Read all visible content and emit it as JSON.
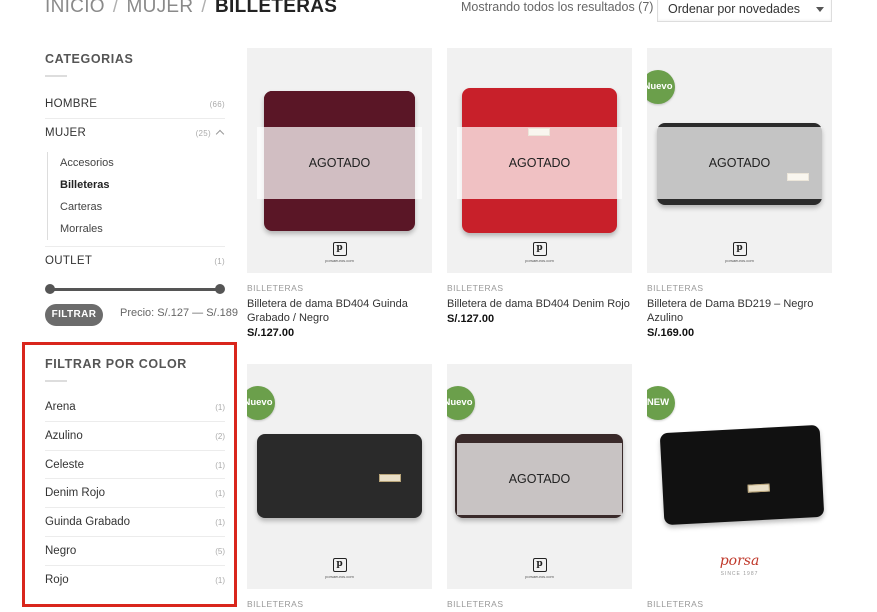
{
  "breadcrumb": {
    "items": [
      "INICIO",
      "MUJER"
    ],
    "separator": "/",
    "current": "BILLETERAS"
  },
  "toolbar": {
    "result_count": "Mostrando todos los resultados (7)",
    "orderby_selected": "Ordenar por novedades"
  },
  "sidebar": {
    "categories_title": "CATEGORIAS",
    "categories": [
      {
        "label": "HOMBRE",
        "count": "(66)"
      },
      {
        "label": "MUJER",
        "count": "(25)",
        "subcategories": [
          "Accesorios",
          "Billeteras",
          "Carteras",
          "Morrales"
        ],
        "active_sub": "Billeteras"
      },
      {
        "label": "OUTLET",
        "count": "(1)"
      }
    ],
    "price_filter": {
      "button_label": "FILTRAR",
      "price_text": "Precio: S/.127 — S/.189",
      "min_fraction": 0,
      "max_fraction": 1
    },
    "color_title": "FILTRAR POR COLOR",
    "colors": [
      {
        "label": "Arena",
        "count": "(1)"
      },
      {
        "label": "Azulino",
        "count": "(2)"
      },
      {
        "label": "Celeste",
        "count": "(1)"
      },
      {
        "label": "Denim Rojo",
        "count": "(1)"
      },
      {
        "label": "Guinda Grabado",
        "count": "(1)"
      },
      {
        "label": "Negro",
        "count": "(5)"
      },
      {
        "label": "Rojo",
        "count": "(1)"
      }
    ]
  },
  "products": [
    {
      "category": "BILLETERAS",
      "name": "Billetera de dama BD404 Guinda Grabado / Negro",
      "price": "S/.127.00",
      "sold_out_label": "AGOTADO",
      "wallet_color": "#5a1626",
      "logo_url": "porsaeuros.com"
    },
    {
      "category": "BILLETERAS",
      "name": "Billetera de dama BD404 Denim Rojo",
      "price": "S/.127.00",
      "sold_out_label": "AGOTADO",
      "wallet_color": "#c8202a",
      "logo_url": "porsaeuros.com"
    },
    {
      "category": "BILLETERAS",
      "name": "Billetera de Dama BD219 – Negro Azulino",
      "price": "S/.169.00",
      "sold_out_label": "AGOTADO",
      "badge": "Nuevo",
      "wallet_color": "#2b2b2b",
      "logo_url": "porsaeuros.com"
    },
    {
      "category": "BILLETERAS",
      "badge": "Nuevo",
      "wallet_color": "#2a2a2a",
      "logo_url": "porsaeuros.com"
    },
    {
      "category": "BILLETERAS",
      "badge": "Nuevo",
      "sold_out_label": "AGOTADO",
      "wallet_color": "#3a2a2a",
      "logo_url": "porsaeuros.com"
    },
    {
      "category": "BILLETERAS",
      "badge": "NEW",
      "wallet_color": "#111111",
      "brand_script": "porsa",
      "brand_since": "SINCE 1987"
    }
  ]
}
